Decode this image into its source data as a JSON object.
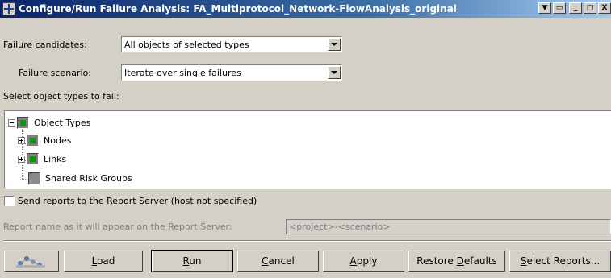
{
  "window": {
    "title": "Configure/Run Failure Analysis: FA_Multiprotocol_Network-FlowAnalysis_original",
    "controls": [
      "▼",
      "▭",
      "_",
      "□",
      "X"
    ]
  },
  "form": {
    "failure_candidates_label": "Failure candidates:",
    "failure_candidates_value": "All objects of selected types",
    "failure_scenario_label": "Failure scenario:",
    "failure_scenario_value": "Iterate over single failures",
    "select_types_label": "Select object types to fail:"
  },
  "tree": {
    "root": "Object Types",
    "children": [
      "Nodes",
      "Links",
      "Shared Risk Groups"
    ]
  },
  "report": {
    "send_label_pre": "S",
    "send_label_u": "e",
    "send_label_post": "nd reports to the Report Server (host not specified)",
    "name_label": "Report name as it will appear on the Report Server:",
    "name_value": "<project>-<scenario>"
  },
  "buttons": {
    "load_u": "L",
    "load_rest": "oad",
    "run_u": "R",
    "run_rest": "un",
    "cancel_u": "C",
    "cancel_rest": "ancel",
    "apply_u": "A",
    "apply_rest": "pply",
    "restore_pre": "Restore ",
    "restore_u": "D",
    "restore_post": "efaults",
    "select_u": "S",
    "select_rest": "elect Reports..."
  }
}
